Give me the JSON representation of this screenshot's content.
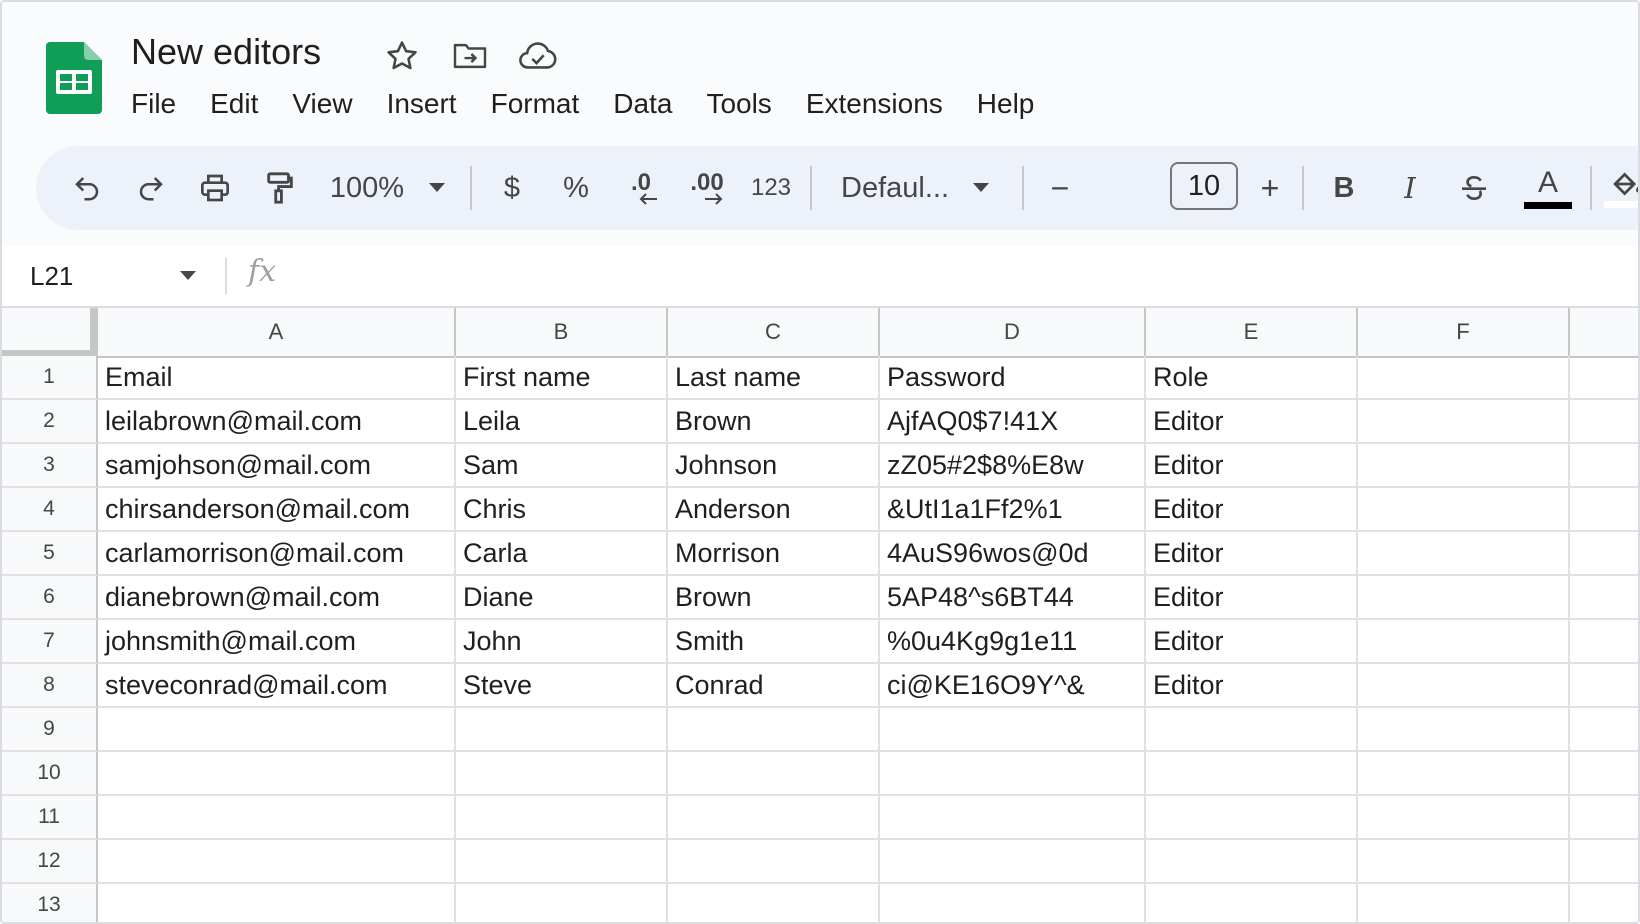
{
  "doc": {
    "title": "New editors"
  },
  "menu": [
    "File",
    "Edit",
    "View",
    "Insert",
    "Format",
    "Data",
    "Tools",
    "Extensions",
    "Help"
  ],
  "toolbar": {
    "zoom": "100%",
    "currency": "$",
    "percent": "%",
    "decrease_decimal": ".0",
    "increase_decimal": ".00",
    "number_format": "123",
    "font": "Defaul...",
    "font_size": "10",
    "minus": "−",
    "plus": "+",
    "bold": "B",
    "italic": "I",
    "text_color_glyph": "A"
  },
  "colors": {
    "sheets_green": "#0f9d58",
    "toolbar_bg": "#edf2fa",
    "header_bg": "#f9fbfd"
  },
  "formula_bar": {
    "name_box": "L21",
    "fx": "fx"
  },
  "columns": [
    "A",
    "B",
    "C",
    "D",
    "E",
    "F"
  ],
  "rows": [
    "1",
    "2",
    "3",
    "4",
    "5",
    "6",
    "7",
    "8",
    "9",
    "10",
    "11",
    "12",
    "13"
  ],
  "cells": [
    [
      "Email",
      "First name",
      "Last name",
      "Password",
      "Role",
      ""
    ],
    [
      "leilabrown@mail.com",
      "Leila",
      "Brown",
      "AjfAQ0$7!41X",
      "Editor",
      ""
    ],
    [
      "samjohson@mail.com",
      "Sam",
      "Johnson",
      "zZ05#2$8%E8w",
      "Editor",
      ""
    ],
    [
      "chirsanderson@mail.com",
      "Chris",
      "Anderson",
      "&UtI1a1Ff2%1",
      "Editor",
      ""
    ],
    [
      "carlamorrison@mail.com",
      "Carla",
      "Morrison",
      "4AuS96wos@0d",
      "Editor",
      ""
    ],
    [
      "dianebrown@mail.com",
      "Diane",
      "Brown",
      "5AP48^s6BT44",
      "Editor",
      ""
    ],
    [
      "johnsmith@mail.com",
      "John",
      "Smith",
      "%0u4Kg9g1e11",
      "Editor",
      ""
    ],
    [
      "steveconrad@mail.com",
      "Steve",
      "Conrad",
      "ci@KE16O9Y^&",
      "Editor",
      ""
    ],
    [
      "",
      "",
      "",
      "",
      "",
      ""
    ],
    [
      "",
      "",
      "",
      "",
      "",
      ""
    ],
    [
      "",
      "",
      "",
      "",
      "",
      ""
    ],
    [
      "",
      "",
      "",
      "",
      "",
      ""
    ],
    [
      "",
      "",
      "",
      "",
      "",
      ""
    ]
  ]
}
